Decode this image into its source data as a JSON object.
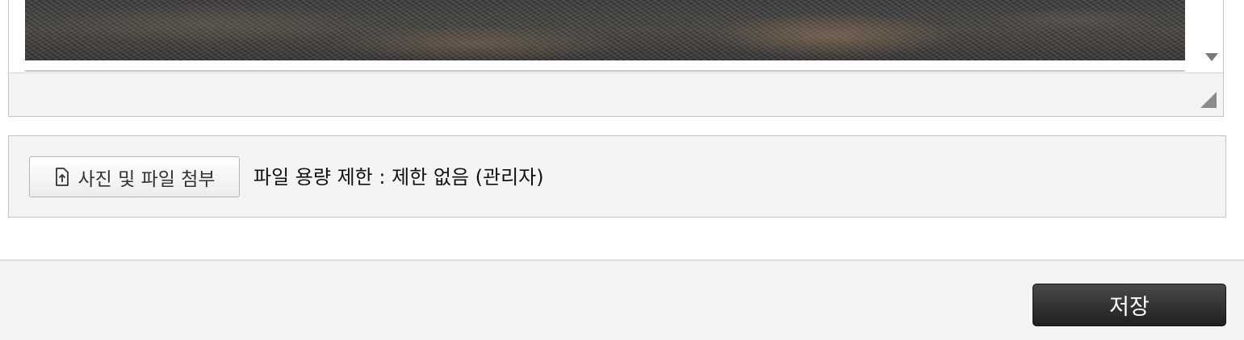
{
  "editor": {
    "content_image": "gravel-photo",
    "scroll_down_icon": "triangle-down-icon",
    "resize_icon": "resize-handle-icon"
  },
  "attachments": {
    "button_icon": "file-upload-icon",
    "button_label": "사진 및 파일 첨부",
    "limit_text": "파일 용량 제한 : 제한 없음 (관리자)"
  },
  "footer": {
    "save_label": "저장",
    "save_color": "#2b2b2b"
  },
  "colors": {
    "panel_bg": "#f3f5f4",
    "border": "#c3c5c5",
    "footer_bg": "#f3f3f3"
  }
}
